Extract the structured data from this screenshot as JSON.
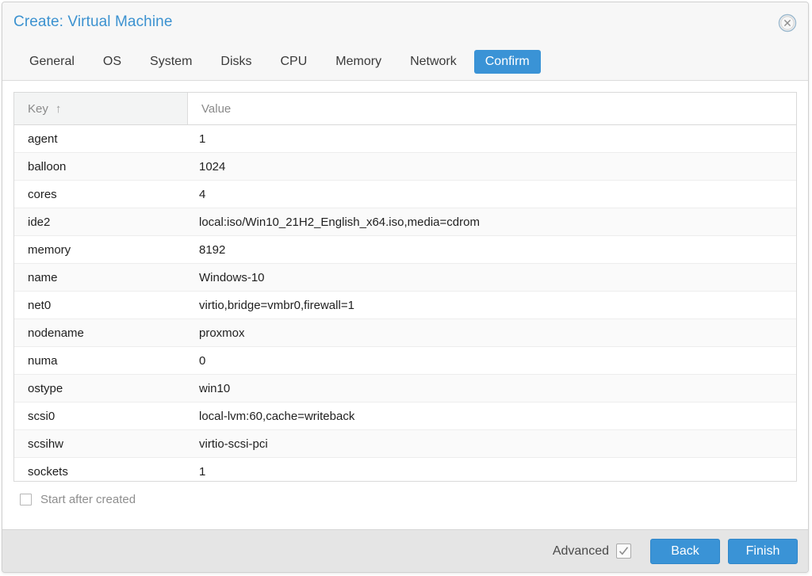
{
  "dialog": {
    "title": "Create: Virtual Machine",
    "close_icon": "close-circle-icon"
  },
  "tabs": [
    {
      "label": "General",
      "active": false
    },
    {
      "label": "OS",
      "active": false
    },
    {
      "label": "System",
      "active": false
    },
    {
      "label": "Disks",
      "active": false
    },
    {
      "label": "CPU",
      "active": false
    },
    {
      "label": "Memory",
      "active": false
    },
    {
      "label": "Network",
      "active": false
    },
    {
      "label": "Confirm",
      "active": true
    }
  ],
  "grid": {
    "columns": [
      {
        "label": "Key",
        "sorted": true,
        "sort_indicator": "↑"
      },
      {
        "label": "Value",
        "sorted": false,
        "sort_indicator": ""
      }
    ],
    "rows": [
      {
        "key": "agent",
        "value": "1"
      },
      {
        "key": "balloon",
        "value": "1024"
      },
      {
        "key": "cores",
        "value": "4"
      },
      {
        "key": "ide2",
        "value": "local:iso/Win10_21H2_English_x64.iso,media=cdrom"
      },
      {
        "key": "memory",
        "value": "8192"
      },
      {
        "key": "name",
        "value": "Windows-10"
      },
      {
        "key": "net0",
        "value": "virtio,bridge=vmbr0,firewall=1"
      },
      {
        "key": "nodename",
        "value": "proxmox"
      },
      {
        "key": "numa",
        "value": "0"
      },
      {
        "key": "ostype",
        "value": "win10"
      },
      {
        "key": "scsi0",
        "value": "local-lvm:60,cache=writeback"
      },
      {
        "key": "scsihw",
        "value": "virtio-scsi-pci"
      },
      {
        "key": "sockets",
        "value": "1"
      }
    ]
  },
  "start_after_created": {
    "label": "Start after created",
    "checked": false
  },
  "footer": {
    "advanced_label": "Advanced",
    "advanced_checked": true,
    "back_label": "Back",
    "finish_label": "Finish"
  },
  "colors": {
    "accent_blue": "#3a93d6",
    "title_blue": "#3c92d0",
    "footer_gray": "#e5e5e5",
    "row_alt": "#fafafa",
    "header_gray": "#f3f4f4"
  }
}
